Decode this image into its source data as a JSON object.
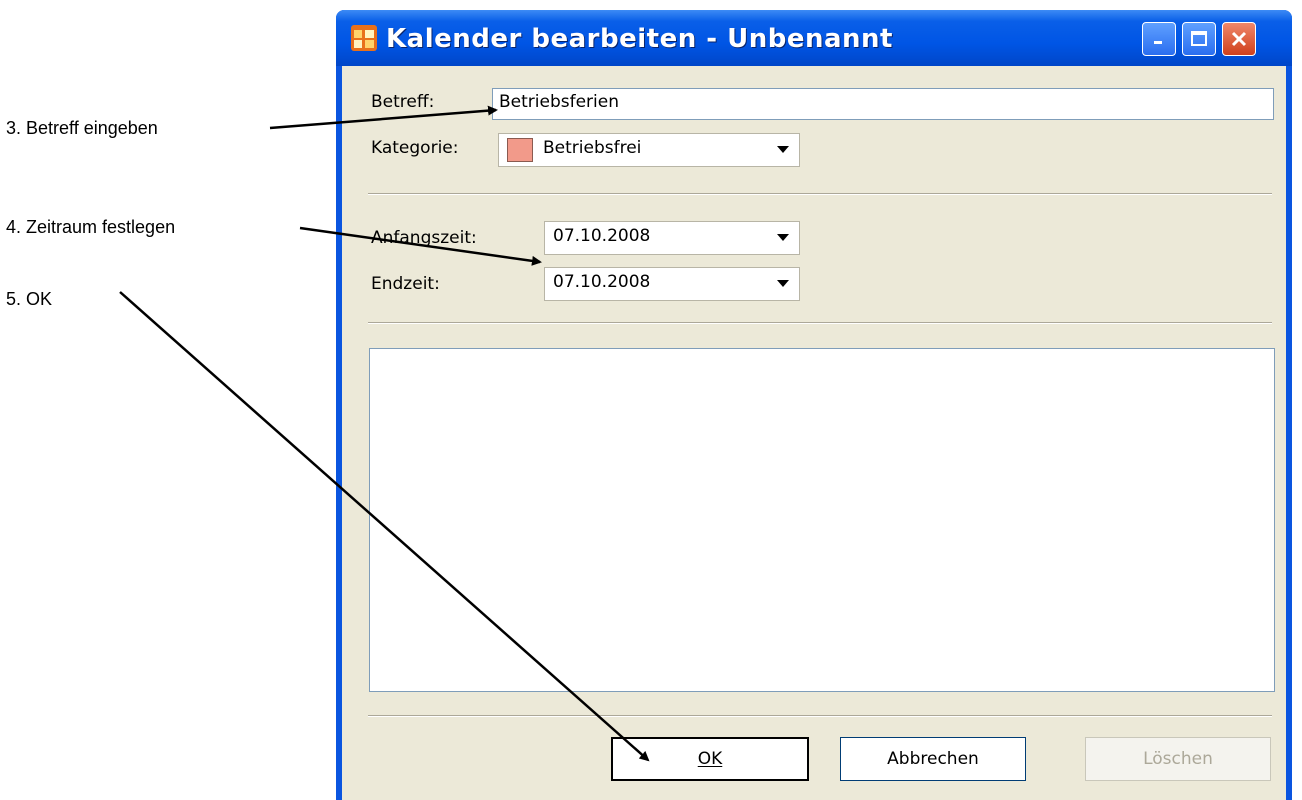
{
  "annotations": {
    "step3": "3. Betreff eingeben",
    "step4": "4. Zeitraum festlegen",
    "step5": "5. OK"
  },
  "window": {
    "title": "Kalender bearbeiten - Unbenannt"
  },
  "form": {
    "subject_label": "Betreff:",
    "subject_value": "Betriebsferien",
    "category_label": "Kategorie:",
    "category_value": "Betriebsfrei",
    "category_color": "#f29a8a",
    "start_label": "Anfangszeit:",
    "start_value": "07.10.2008",
    "end_label": "Endzeit:",
    "end_value": "07.10.2008",
    "notes_value": ""
  },
  "buttons": {
    "ok": "OK",
    "cancel": "Abbrechen",
    "delete": "Löschen"
  },
  "icons": {
    "app": "calendar-app-icon",
    "minimize": "minimize-icon",
    "maximize": "maximize-icon",
    "close": "close-icon",
    "dropdown": "chevron-down-icon"
  }
}
